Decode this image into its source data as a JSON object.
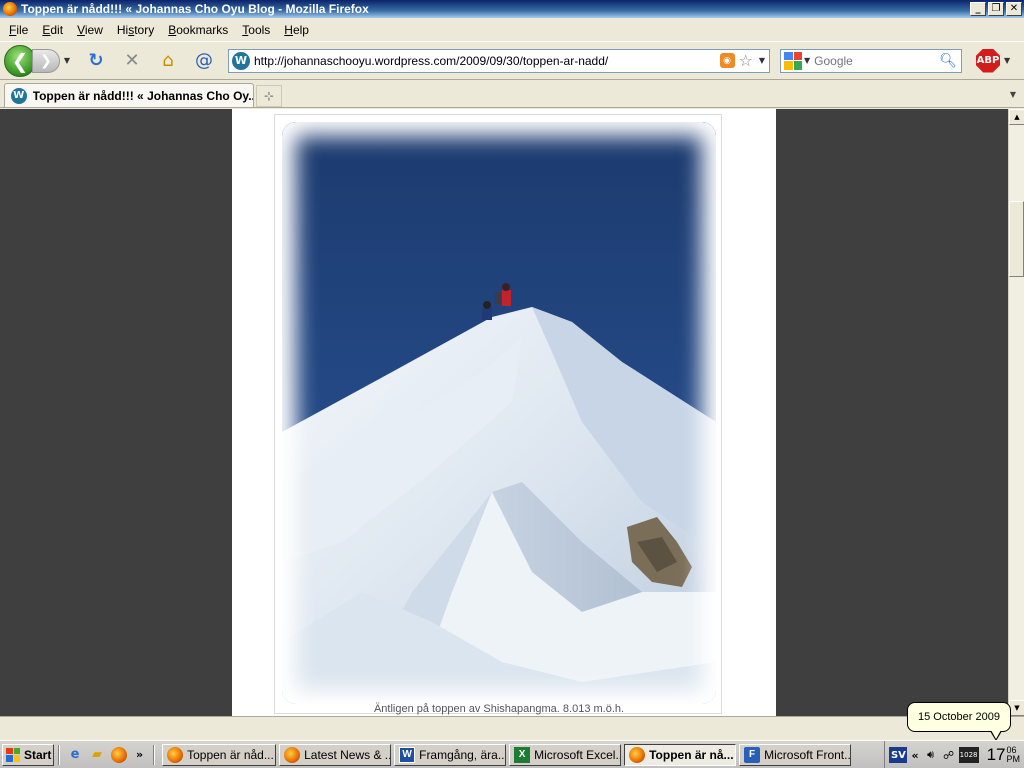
{
  "window": {
    "title": "Toppen är nådd!!! « Johannas Cho Oyu Blog - Mozilla Firefox"
  },
  "menu": [
    {
      "key": "F",
      "rest": "ile"
    },
    {
      "key": "E",
      "rest": "dit"
    },
    {
      "key": "V",
      "rest": "iew"
    },
    {
      "key": "H",
      "rest": "istory",
      "pre": "Hi",
      "post": "story"
    },
    {
      "key": "B",
      "rest": "ookmarks"
    },
    {
      "key": "T",
      "rest": "ools"
    },
    {
      "key": "H",
      "rest": "elp"
    }
  ],
  "nav": {
    "url": "http://johannaschooyu.wordpress.com/2009/09/30/toppen-ar-nadd/",
    "search_placeholder": "Google"
  },
  "tabs": [
    {
      "label": "Toppen är nådd!!! « Johannas Cho Oy..."
    }
  ],
  "content": {
    "caption": "Äntligen på toppen av Shishapangma. 8.013 m.ö.h."
  },
  "tooltip": {
    "date": "15 October 2009"
  },
  "taskbar": {
    "start_label": "Start",
    "tasks": [
      {
        "label": "Toppen är nåd...",
        "icon": "firefox-icon",
        "active": false
      },
      {
        "label": "Latest News & ...",
        "icon": "firefox-icon",
        "active": false
      },
      {
        "label": "Framgång, ära...",
        "icon": "word-icon",
        "active": false
      },
      {
        "label": "Microsoft Excel...",
        "icon": "excel-icon",
        "active": false
      },
      {
        "label": "Toppen är nå...",
        "icon": "firefox-icon",
        "active": true
      },
      {
        "label": "Microsoft Front...",
        "icon": "frontpage-icon",
        "active": false
      }
    ],
    "language": "SV",
    "clock": {
      "hour": "17",
      "minute": "06",
      "ampm": "PM"
    },
    "tray_counter": "1028"
  }
}
